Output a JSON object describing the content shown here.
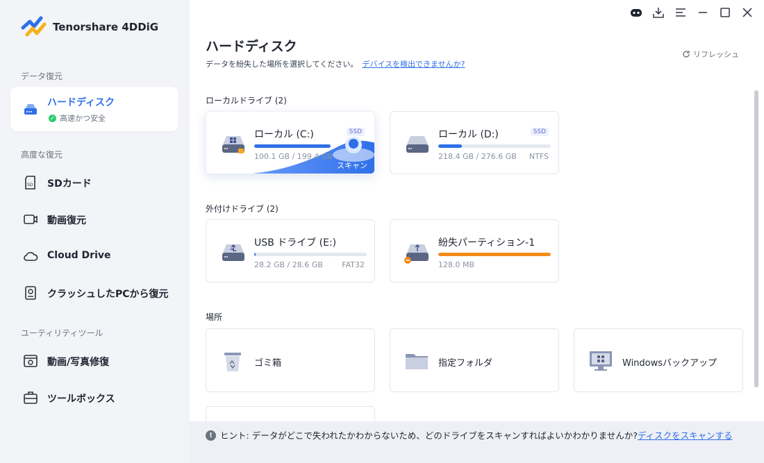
{
  "app": {
    "name": "Tenorshare 4DDiG"
  },
  "sidebar": {
    "sections": [
      {
        "label": "データ復元"
      },
      {
        "label": "高度な復元"
      },
      {
        "label": "ユーティリティツール"
      }
    ],
    "items": [
      {
        "label": "ハードディスク",
        "sub": "高速かつ安全",
        "icon": "hard-disk-icon",
        "active": true
      },
      {
        "label": "SDカード",
        "icon": "sd-card-icon"
      },
      {
        "label": "動画復元",
        "icon": "video-icon"
      },
      {
        "label": "Cloud Drive",
        "icon": "cloud-icon"
      },
      {
        "label": "クラッシュしたPCから復元",
        "icon": "crashed-pc-icon"
      },
      {
        "label": "動画/写真修復",
        "icon": "repair-icon"
      },
      {
        "label": "ツールボックス",
        "icon": "toolbox-icon"
      }
    ]
  },
  "header": {
    "title": "ハードディスク",
    "subtitle": "データを紛失した場所を選択してください。",
    "link": "デバイスを検出できませんか?",
    "refresh": "リフレッシュ"
  },
  "groups": {
    "local": "ローカルドライブ (2)",
    "external": "外付けドライブ (2)",
    "location": "場所"
  },
  "local_drives": [
    {
      "name": "ローカル (C:)",
      "badge": "SSD",
      "size": "100.1 GB / 199.4 GB",
      "fs": "",
      "usage": 0.502,
      "scan": "スキャン"
    },
    {
      "name": "ローカル (D:)",
      "badge": "SSD",
      "size": "218.4 GB / 276.6 GB",
      "fs": "NTFS",
      "usage": 0.21
    }
  ],
  "external_drives": [
    {
      "name": "USB ドライブ (E:)",
      "size": "28.2 GB / 28.6 GB",
      "fs": "FAT32",
      "usage": 0.014
    },
    {
      "name": "紛失パーティション-1",
      "size": "128.0 MB",
      "fs": "",
      "usage": 1.0,
      "color": "#f28c1a"
    }
  ],
  "locations": [
    {
      "name": "ゴミ箱",
      "icon": "recycle-bin-icon"
    },
    {
      "name": "指定フォルダ",
      "icon": "folder-icon"
    },
    {
      "name": "Windowsバックアップ",
      "icon": "windows-backup-icon"
    }
  ],
  "hint": {
    "prefix": "ヒント:",
    "text": "データがどこで失われたかわからないため、どのドライブをスキャンすればよいかわかりませんか?",
    "link": "ディスクをスキャンする"
  },
  "colors": {
    "accent": "#2f6fe8",
    "warning": "#f28c1a"
  }
}
